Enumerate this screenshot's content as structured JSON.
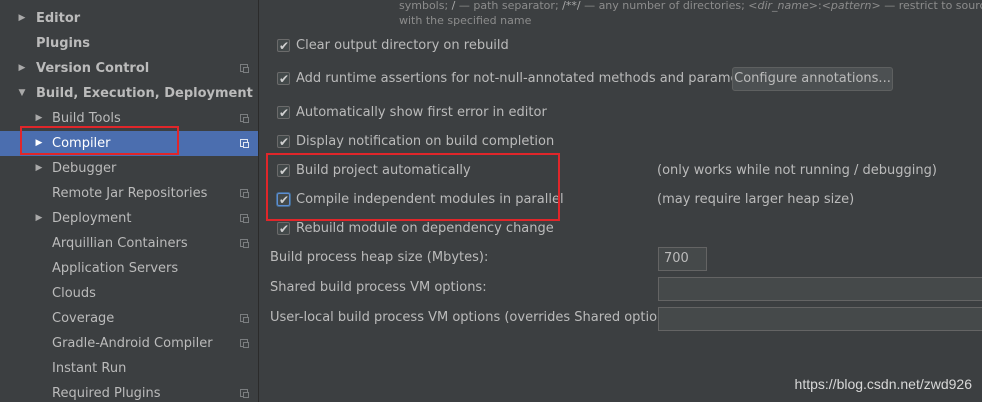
{
  "sidebar": {
    "items": [
      {
        "label": "Editor"
      },
      {
        "label": "Plugins"
      },
      {
        "label": "Version Control"
      },
      {
        "label": "Build, Execution, Deployment"
      },
      {
        "label": "Build Tools"
      },
      {
        "label": "Compiler"
      },
      {
        "label": "Debugger"
      },
      {
        "label": "Remote Jar Repositories"
      },
      {
        "label": "Deployment"
      },
      {
        "label": "Arquillian Containers"
      },
      {
        "label": "Application Servers"
      },
      {
        "label": "Clouds"
      },
      {
        "label": "Coverage"
      },
      {
        "label": "Gradle-Android Compiler"
      },
      {
        "label": "Instant Run"
      },
      {
        "label": "Required Plugins"
      }
    ]
  },
  "hint": {
    "line1_a": "symbols; ",
    "line1_b": "/",
    "line1_c": " — path separator; ",
    "line1_d": "/**/",
    "line1_e": " — any number of directories; ",
    "line1_f": "<dir_name>",
    "line1_g": ":",
    "line1_h": "<pattern>",
    "line1_i": " — restrict to source root",
    "line2": "with the specified name"
  },
  "options": [
    {
      "label": "Clear output directory on rebuild",
      "checked": true
    },
    {
      "label": "Add runtime assertions for not-null-annotated methods and parameters",
      "checked": true
    },
    {
      "label": "Automatically show first error in editor",
      "checked": true
    },
    {
      "label": "Display notification on build completion",
      "checked": true
    },
    {
      "label": "Build project automatically",
      "checked": true,
      "note": "(only works while not running / debugging)"
    },
    {
      "label": "Compile independent modules in parallel",
      "checked": true,
      "note": "(may require larger heap size)"
    },
    {
      "label": "Rebuild module on dependency change",
      "checked": true
    }
  ],
  "configure_button": "Configure annotations...",
  "fields": [
    {
      "label": "Build process heap size (Mbytes):",
      "value": "700"
    },
    {
      "label": "Shared build process VM options:",
      "value": ""
    },
    {
      "label": "User-local build process VM options (overrides Shared options):",
      "value": ""
    }
  ],
  "watermark": "https://blog.csdn.net/zwd926",
  "colors": {
    "selection": "#4b6eaf",
    "background": "#3c3f41",
    "annotation_red": "#e0262a"
  }
}
